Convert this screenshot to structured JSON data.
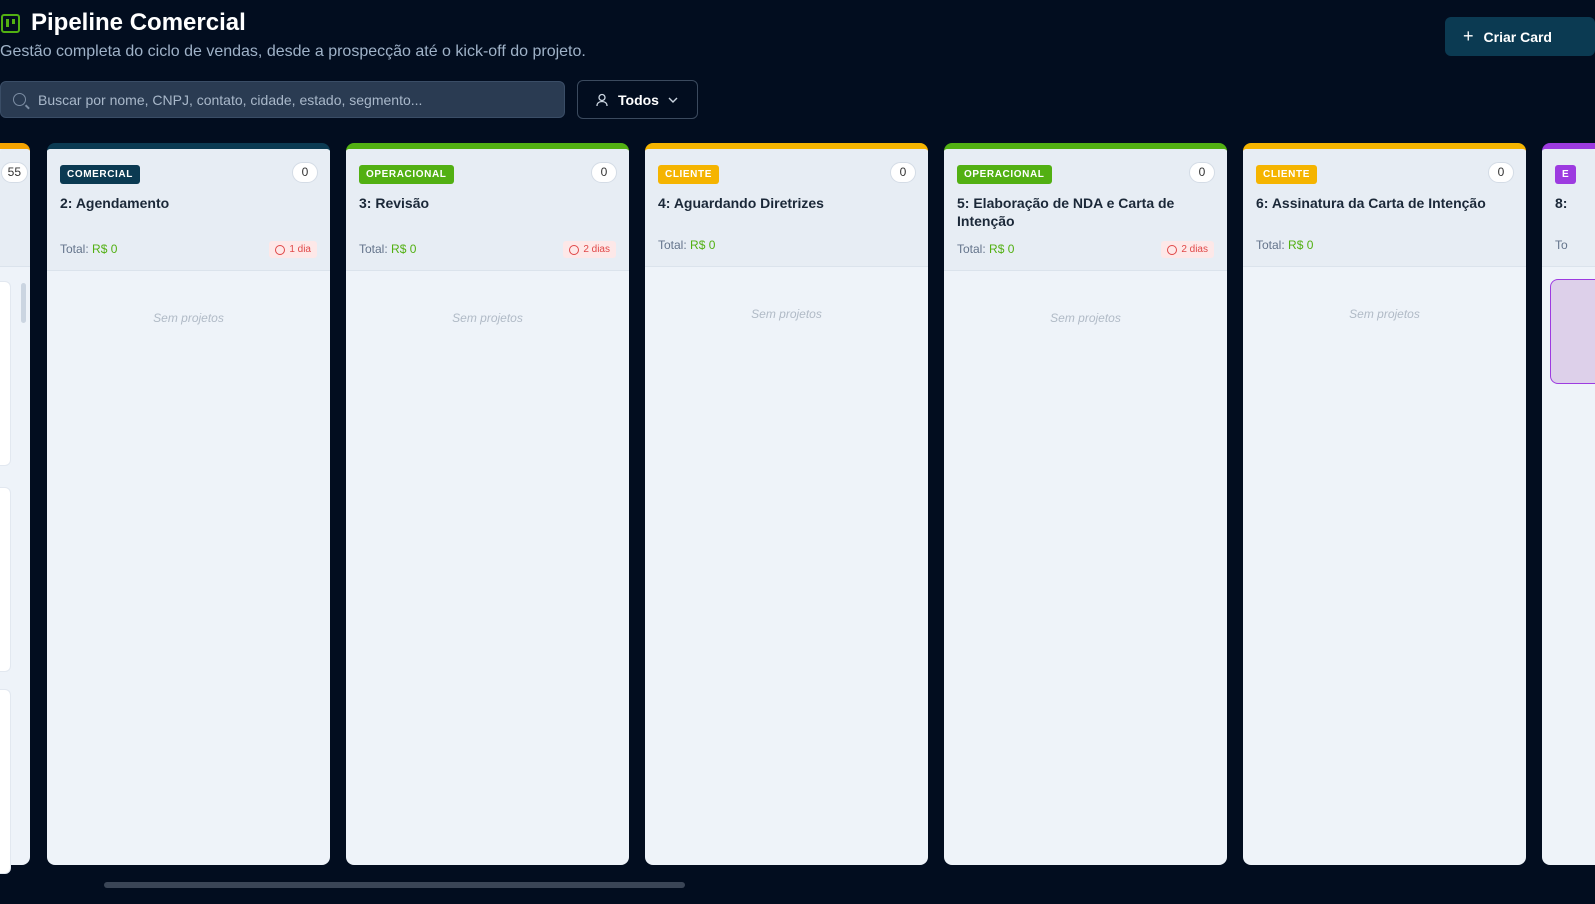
{
  "header": {
    "title": "Pipeline Comercial",
    "subtitle": "Gestão completa do ciclo de vendas, desde a prospecção até o kick-off do projeto.",
    "create_label": "Criar Card"
  },
  "search": {
    "placeholder": "Buscar por nome, CNPJ, contato, cidade, estado, segmento...",
    "value": ""
  },
  "filter": {
    "selected": "Todos"
  },
  "colors": {
    "comercial": "#0b3a52",
    "operacional": "#52b012",
    "cliente": "#f5b400",
    "other": "#9d3be0"
  },
  "columns": [
    {
      "badge": "",
      "title": "",
      "count": "55",
      "color": "#f5a300",
      "total": "",
      "age": "",
      "empty": ""
    },
    {
      "badge": "COMERCIAL",
      "title": "2: Agendamento",
      "count": "0",
      "color": "#0b3a52",
      "total_label": "Total:",
      "total": "R$ 0",
      "age": "1 dia",
      "empty": "Sem projetos"
    },
    {
      "badge": "OPERACIONAL",
      "title": "3: Revisão",
      "count": "0",
      "color": "#52b012",
      "total_label": "Total:",
      "total": "R$ 0",
      "age": "2 dias",
      "empty": "Sem projetos"
    },
    {
      "badge": "CLIENTE",
      "title": "4: Aguardando Diretrizes",
      "count": "0",
      "color": "#f5b400",
      "total_label": "Total:",
      "total": "R$ 0",
      "age": "",
      "empty": "Sem projetos"
    },
    {
      "badge": "OPERACIONAL",
      "title": "5: Elaboração de NDA e Carta de Intenção",
      "count": "0",
      "color": "#52b012",
      "total_label": "Total:",
      "total": "R$ 0",
      "age": "2 dias",
      "empty": "Sem projetos"
    },
    {
      "badge": "CLIENTE",
      "title": "6: Assinatura da Carta de Intenção",
      "count": "0",
      "color": "#f5b400",
      "total_label": "Total:",
      "total": "R$ 0",
      "age": "",
      "empty": "Sem projetos"
    },
    {
      "badge": "E",
      "title": "8:",
      "count": "",
      "color": "#9d3be0",
      "total_label": "To",
      "total": "",
      "age": "",
      "empty": ""
    }
  ]
}
